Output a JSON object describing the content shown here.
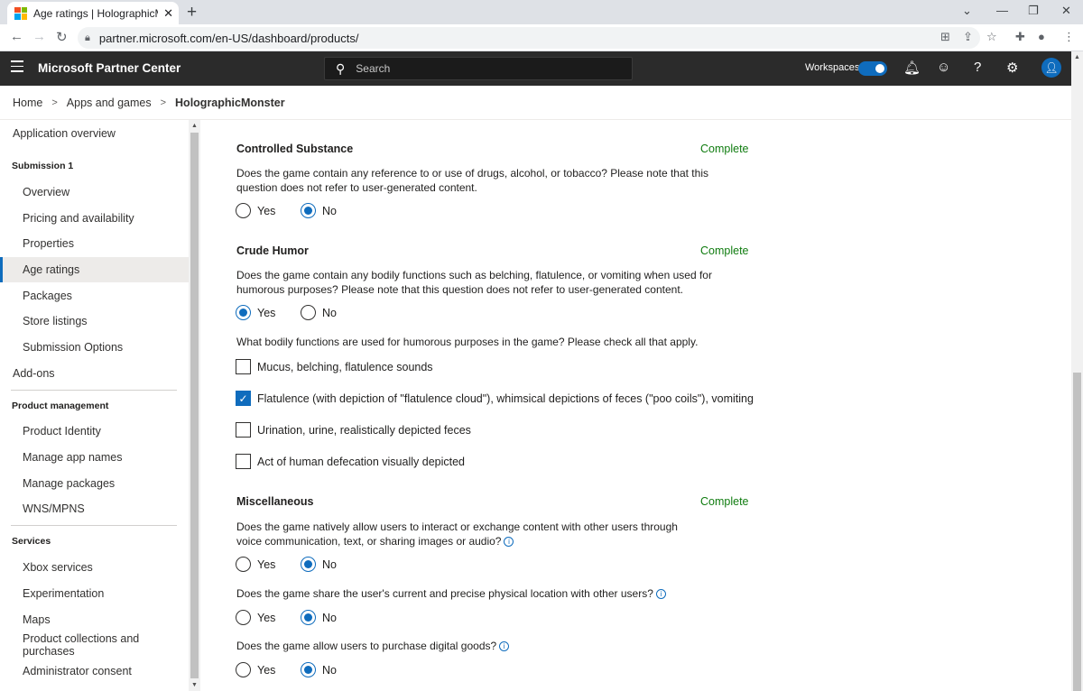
{
  "browser": {
    "tab_title": "Age ratings | HolographicMonster",
    "new_tab": "+",
    "url": "partner.microsoft.com/en-US/dashboard/products/"
  },
  "header": {
    "app_title": "Microsoft Partner Center",
    "search_placeholder": "Search",
    "workspaces_label": "Workspaces",
    "workspaces_on": true
  },
  "breadcrumb": [
    "Home",
    "Apps and games",
    "HolographicMonster"
  ],
  "sidebar": {
    "app_overview": "Application overview",
    "submission_head": "Submission 1",
    "submission_items": [
      "Overview",
      "Pricing and availability",
      "Properties",
      "Age ratings",
      "Packages",
      "Store listings",
      "Submission Options"
    ],
    "addons": "Add-ons",
    "product_mgmt_head": "Product management",
    "product_mgmt_items": [
      "Product Identity",
      "Manage app names",
      "Manage packages",
      "WNS/MPNS"
    ],
    "services_head": "Services",
    "services_items": [
      "Xbox services",
      "Experimentation",
      "Maps",
      "Product collections and purchases",
      "Administrator consent"
    ]
  },
  "sections": {
    "controlled": {
      "title": "Controlled Substance",
      "status": "Complete",
      "question": "Does the game contain any reference to or use of drugs, alcohol, or tobacco? Please note that this question does not refer to user-generated content.",
      "answer": "No"
    },
    "crude": {
      "title": "Crude Humor",
      "status": "Complete",
      "question": "Does the game contain any bodily functions such as belching, flatulence, or vomiting when used for humorous purposes? Please note that this question does not refer to user-generated content.",
      "answer": "Yes",
      "sub_question": "What bodily functions are used for humorous purposes in the game? Please check all that apply.",
      "options": [
        {
          "label": "Mucus, belching, flatulence sounds",
          "checked": false
        },
        {
          "label": "Flatulence (with depiction of \"flatulence cloud\"), whimsical depictions of feces (\"poo coils\"), vomiting",
          "checked": true
        },
        {
          "label": "Urination, urine, realistically depicted feces",
          "checked": false
        },
        {
          "label": "Act of human defecation visually depicted",
          "checked": false
        }
      ]
    },
    "misc": {
      "title": "Miscellaneous",
      "status": "Complete",
      "q1": "Does the game natively allow users to interact or exchange content with other users through voice communication, text, or sharing images or audio?",
      "q1_answer": "No",
      "q2": "Does the game share the user's current and precise physical location with other users?",
      "q2_answer": "No",
      "q3": "Does the game allow users to purchase digital goods?",
      "q3_answer": "No"
    }
  },
  "labels": {
    "yes": "Yes",
    "no": "No"
  },
  "colors": {
    "accent": "#0f6cbd",
    "complete": "#107c10",
    "header_bg": "#2b2b2b"
  }
}
